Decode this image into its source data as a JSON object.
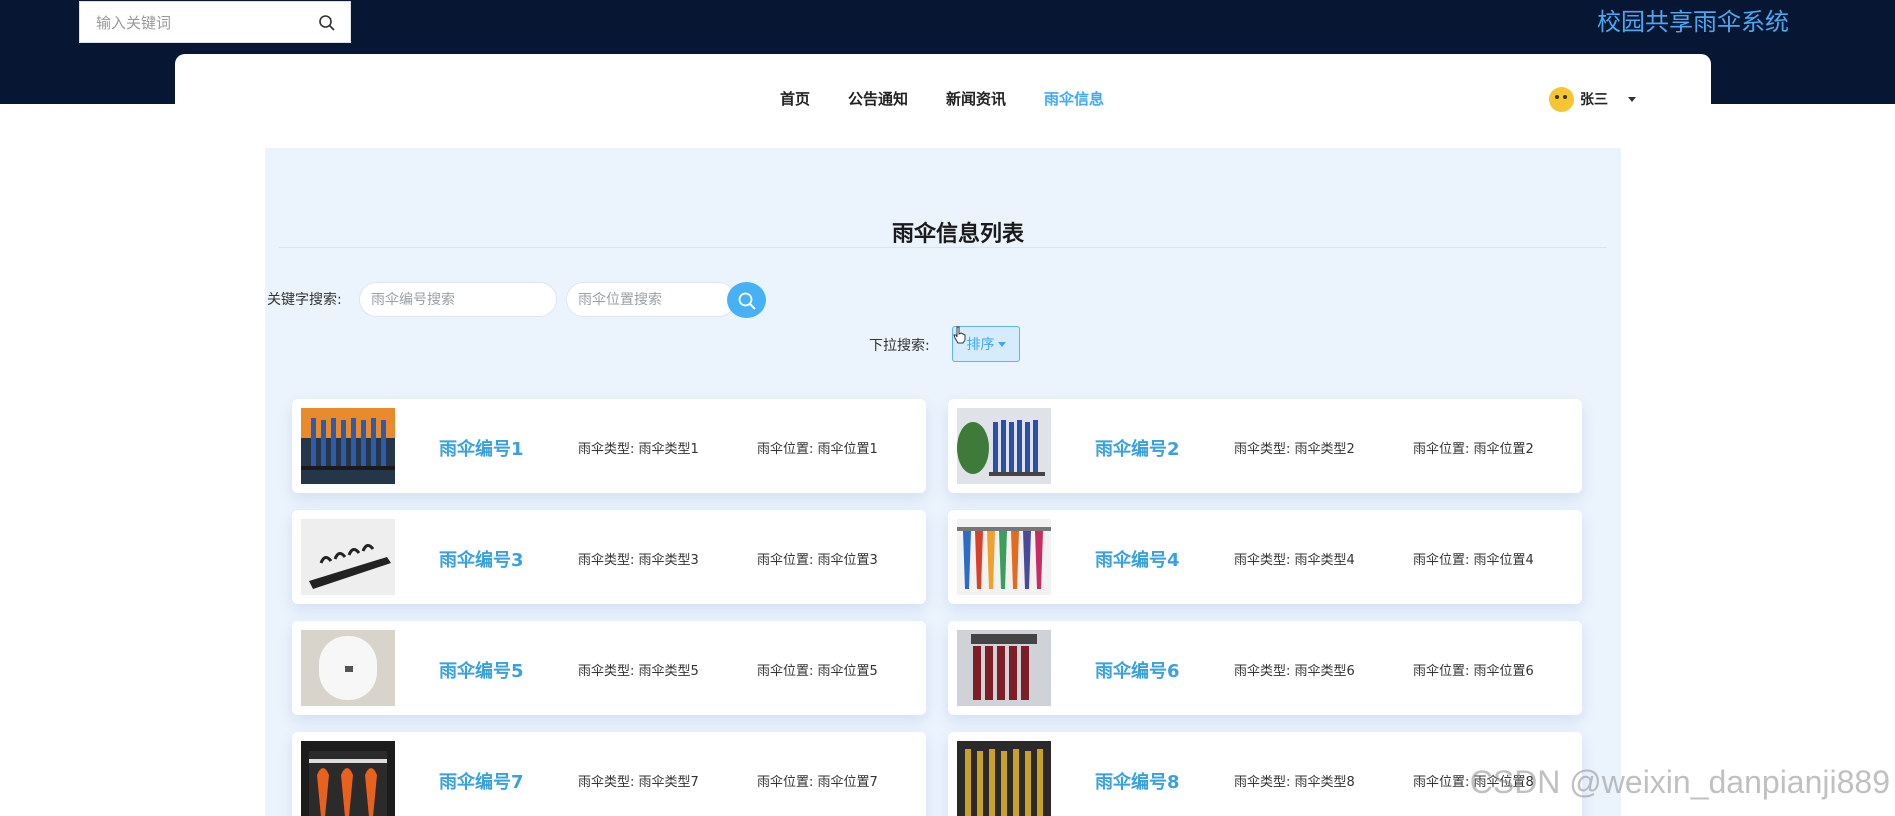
{
  "header": {
    "search_placeholder": "输入关键词",
    "site_title": "校园共享雨伞系统"
  },
  "nav": {
    "items": [
      {
        "label": "首页",
        "active": false
      },
      {
        "label": "公告通知",
        "active": false
      },
      {
        "label": "新闻资讯",
        "active": false
      },
      {
        "label": "雨伞信息",
        "active": true
      }
    ],
    "user_name": "张三"
  },
  "main": {
    "title": "雨伞信息列表",
    "keyword_label": "关键字搜索:",
    "number_placeholder": "雨伞编号搜索",
    "location_placeholder": "雨伞位置搜索",
    "dropdown_label": "下拉搜索:",
    "sort_label": "排序"
  },
  "cards": [
    {
      "name": "雨伞编号1",
      "type": "雨伞类型: 雨伞类型1",
      "location": "雨伞位置: 雨伞位置1"
    },
    {
      "name": "雨伞编号2",
      "type": "雨伞类型: 雨伞类型2",
      "location": "雨伞位置: 雨伞位置2"
    },
    {
      "name": "雨伞编号3",
      "type": "雨伞类型: 雨伞类型3",
      "location": "雨伞位置: 雨伞位置3"
    },
    {
      "name": "雨伞编号4",
      "type": "雨伞类型: 雨伞类型4",
      "location": "雨伞位置: 雨伞位置4"
    },
    {
      "name": "雨伞编号5",
      "type": "雨伞类型: 雨伞类型5",
      "location": "雨伞位置: 雨伞位置5"
    },
    {
      "name": "雨伞编号6",
      "type": "雨伞类型: 雨伞类型6",
      "location": "雨伞位置: 雨伞位置6"
    },
    {
      "name": "雨伞编号7",
      "type": "雨伞类型: 雨伞类型7",
      "location": "雨伞位置: 雨伞位置7"
    },
    {
      "name": "雨伞编号8",
      "type": "雨伞类型: 雨伞类型8",
      "location": "雨伞位置: 雨伞位置8"
    }
  ],
  "watermark": "CSDN @weixin_danpianji889",
  "colors": {
    "top_banner": "#071633",
    "accent": "#3fa9f5",
    "panel": "#ebf3fd",
    "card_title": "#3aa1dc"
  }
}
